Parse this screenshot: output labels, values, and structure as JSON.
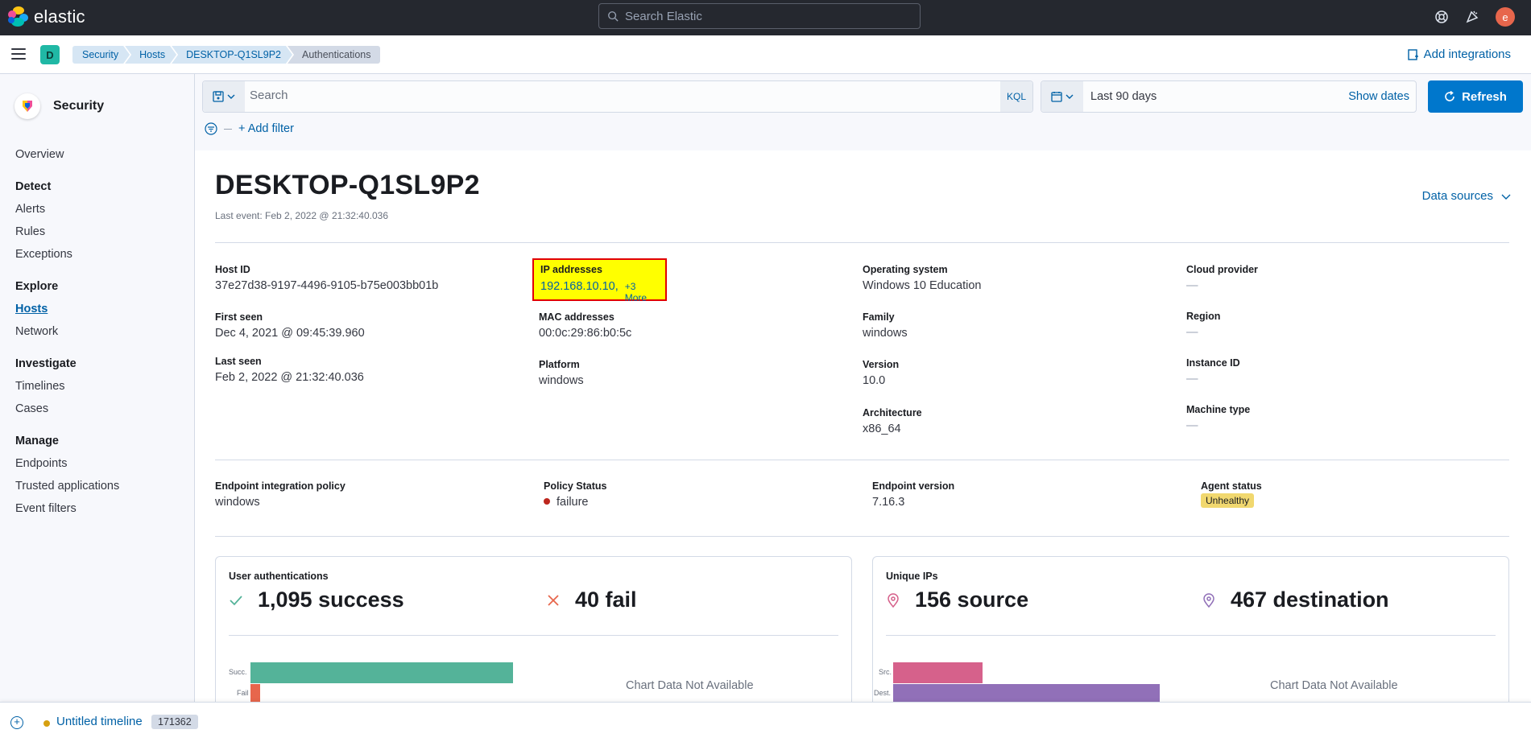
{
  "header": {
    "logo_text": "elastic",
    "search_placeholder": "Search Elastic",
    "avatar_initial": "e"
  },
  "breadcrumbs": {
    "space_initial": "D",
    "items": [
      "Security",
      "Hosts",
      "DESKTOP-Q1SL9P2",
      "Authentications"
    ],
    "add_integrations": "Add integrations"
  },
  "sidebar": {
    "title": "Security",
    "overview": "Overview",
    "groups": [
      {
        "title": "Detect",
        "items": [
          "Alerts",
          "Rules",
          "Exceptions"
        ]
      },
      {
        "title": "Explore",
        "items": [
          "Hosts",
          "Network"
        ]
      },
      {
        "title": "Investigate",
        "items": [
          "Timelines",
          "Cases"
        ]
      },
      {
        "title": "Manage",
        "items": [
          "Endpoints",
          "Trusted applications",
          "Event filters"
        ]
      }
    ],
    "active": "Hosts"
  },
  "query": {
    "search_placeholder": "Search",
    "kql": "KQL",
    "date_range": "Last 90 days",
    "show_dates": "Show dates",
    "refresh": "Refresh",
    "add_filter": "+ Add filter"
  },
  "host": {
    "title": "DESKTOP-Q1SL9P2",
    "last_event": "Last event: Feb 2, 2022 @ 21:32:40.036",
    "data_sources": "Data sources",
    "col1": [
      {
        "label": "Host ID",
        "value": "37e27d38-9197-4496-9105-b75e003bb01b"
      },
      {
        "label": "First seen",
        "value": "Dec 4, 2021 @ 09:45:39.960"
      },
      {
        "label": "Last seen",
        "value": "Feb 2, 2022 @ 21:32:40.036"
      }
    ],
    "ip": {
      "label": "IP addresses",
      "value": "192.168.10.10,",
      "more": "+3 More"
    },
    "col2": [
      {
        "label": "MAC addresses",
        "value": "00:0c:29:86:b0:5c"
      },
      {
        "label": "Platform",
        "value": "windows"
      }
    ],
    "col3": [
      {
        "label": "Operating system",
        "value": "Windows 10 Education"
      },
      {
        "label": "Family",
        "value": "windows"
      },
      {
        "label": "Version",
        "value": "10.0"
      },
      {
        "label": "Architecture",
        "value": "x86_64"
      }
    ],
    "col4": [
      {
        "label": "Cloud provider",
        "value": "—"
      },
      {
        "label": "Region",
        "value": "—"
      },
      {
        "label": "Instance ID",
        "value": "—"
      },
      {
        "label": "Machine type",
        "value": "—"
      }
    ],
    "endpoint": [
      {
        "label": "Endpoint integration policy",
        "value": "windows"
      },
      {
        "label": "Policy Status",
        "value": "failure"
      },
      {
        "label": "Endpoint version",
        "value": "7.16.3"
      },
      {
        "label": "Agent status",
        "value": "Unhealthy"
      }
    ]
  },
  "panels": {
    "auth": {
      "title": "User authentications",
      "success": "1,095 success",
      "fail": "40 fail",
      "bar_success_label": "Succ.",
      "bar_fail_label": "Fail",
      "no_data": "Chart Data Not Available"
    },
    "ips": {
      "title": "Unique IPs",
      "source": "156 source",
      "destination": "467 destination",
      "bar_src_label": "Src.",
      "bar_dest_label": "Dest.",
      "no_data": "Chart Data Not Available"
    }
  },
  "chart_data": [
    {
      "type": "bar",
      "categories": [
        "Succ.",
        "Fail"
      ],
      "values": [
        1095,
        40
      ],
      "colors": [
        "#54b399",
        "#e7664c"
      ]
    },
    {
      "type": "bar",
      "categories": [
        "Src.",
        "Dest."
      ],
      "values": [
        156,
        467
      ],
      "colors": [
        "#d6618b",
        "#9170b8"
      ]
    }
  ],
  "timeline": {
    "name": "Untitled timeline",
    "count": "171362"
  },
  "colors": {
    "primary": "#0077cc",
    "link": "#0061a6",
    "header_bg": "#25282f",
    "highlight": "#ffff00",
    "highlight_border": "#e10000"
  }
}
